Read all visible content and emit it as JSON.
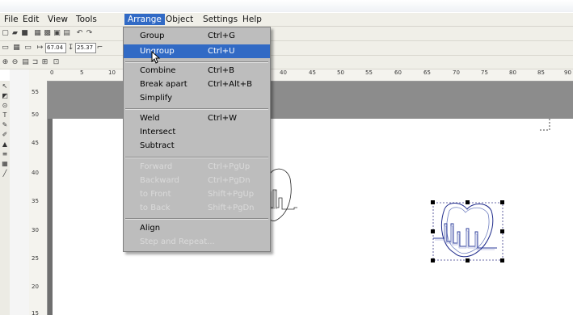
{
  "menubar": {
    "items": [
      {
        "label": "File"
      },
      {
        "label": "Edit"
      },
      {
        "label": "View"
      },
      {
        "label": "Tools"
      },
      {
        "label": "Arrange"
      },
      {
        "label": "Object"
      },
      {
        "label": "Settings"
      },
      {
        "label": "Help"
      }
    ],
    "active_index": 4
  },
  "toolbar2": {
    "x_value": "67.04",
    "y_value": "25.37"
  },
  "ruler": {
    "horizontal": [
      "0",
      "5",
      "10",
      "40",
      "45",
      "50",
      "55",
      "60",
      "65",
      "70",
      "75",
      "80",
      "85",
      "90"
    ],
    "vertical": [
      "55",
      "50",
      "45",
      "40",
      "35",
      "30",
      "25",
      "20",
      "15"
    ]
  },
  "arrange_menu": {
    "items": [
      {
        "label": "Group",
        "shortcut": "Ctrl+G",
        "enabled": true,
        "highlighted": false
      },
      {
        "label": "Ungroup",
        "shortcut": "Ctrl+U",
        "enabled": true,
        "highlighted": true
      },
      {
        "label": "Combine",
        "shortcut": "Ctrl+B",
        "enabled": true,
        "highlighted": false
      },
      {
        "label": "Break apart",
        "shortcut": "Ctrl+Alt+B",
        "enabled": true,
        "highlighted": false
      },
      {
        "label": "Simplify",
        "shortcut": "",
        "enabled": true,
        "highlighted": false
      },
      {
        "label": "Weld",
        "shortcut": "Ctrl+W",
        "enabled": true,
        "highlighted": false
      },
      {
        "label": "Intersect",
        "shortcut": "",
        "enabled": true,
        "highlighted": false
      },
      {
        "label": "Subtract",
        "shortcut": "",
        "enabled": true,
        "highlighted": false
      },
      {
        "label": "Forward",
        "shortcut": "Ctrl+PgUp",
        "enabled": false,
        "highlighted": false
      },
      {
        "label": "Backward",
        "shortcut": "Ctrl+PgDn",
        "enabled": false,
        "highlighted": false
      },
      {
        "label": "to Front",
        "shortcut": "Shift+PgUp",
        "enabled": false,
        "highlighted": false
      },
      {
        "label": "to Back",
        "shortcut": "Shift+PgDn",
        "enabled": false,
        "highlighted": false
      },
      {
        "label": "Align",
        "shortcut": "",
        "enabled": true,
        "highlighted": false
      },
      {
        "label": "Step and Repeat...",
        "shortcut": "",
        "enabled": false,
        "highlighted": false
      }
    ]
  },
  "colors": {
    "highlight": "#316ac5",
    "menu_bg": "#bdbdbd",
    "selection_outline": "#3a3a8a"
  }
}
